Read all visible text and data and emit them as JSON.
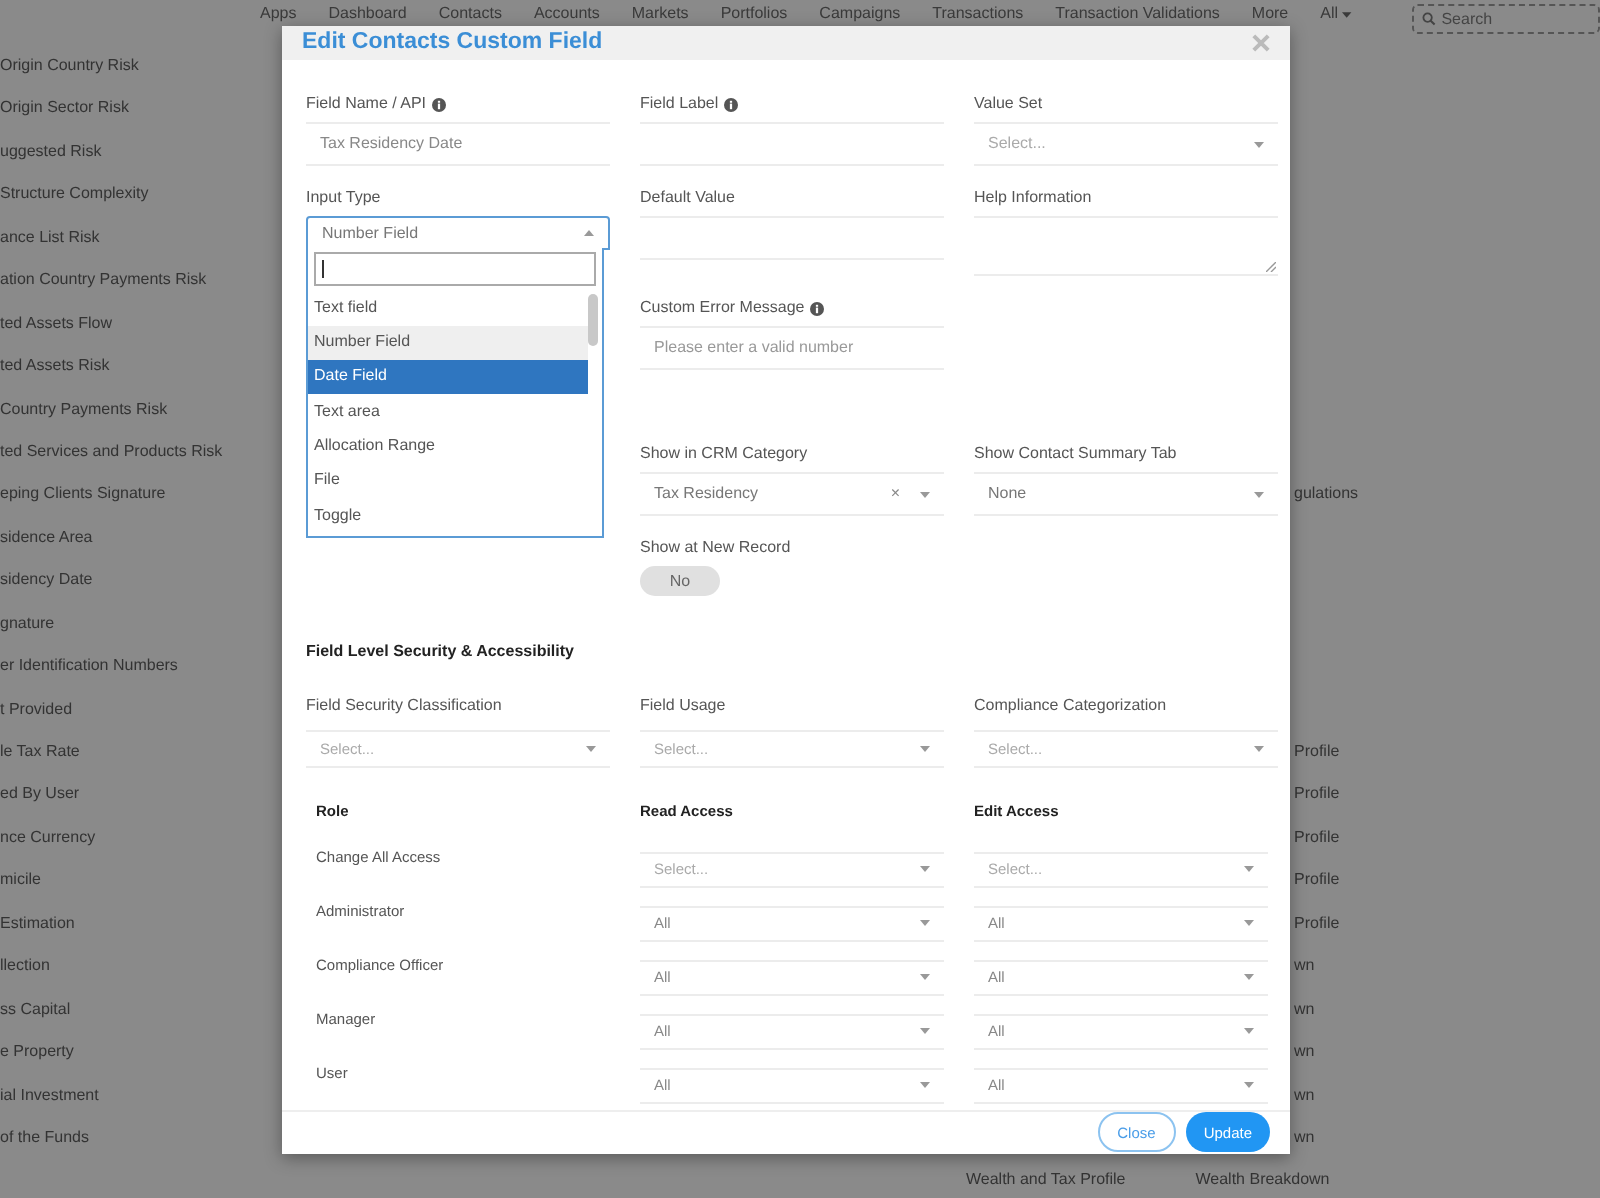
{
  "nav": {
    "items": [
      "Apps",
      "Dashboard",
      "Contacts",
      "Accounts",
      "Markets",
      "Portfolios",
      "Campaigns",
      "Transactions",
      "Transaction Validations",
      "More",
      "All"
    ],
    "search": {
      "placeholder": "Search"
    }
  },
  "background": {
    "left_list": [
      "Origin Country Risk",
      "Origin Sector Risk",
      "uggested Risk",
      "Structure Complexity",
      "ance List Risk",
      "ation Country Payments Risk",
      "ted Assets Flow",
      "ted Assets Risk",
      "Country Payments Risk",
      "ted Services and Products Risk",
      "eping Clients Signature",
      "sidence Area",
      "sidency Date",
      "gnature",
      "er Identification Numbers",
      "t Provided",
      "le Tax Rate",
      "ed By User",
      "nce Currency",
      "micile",
      "Estimation",
      "llection",
      "ss Capital",
      "e Property",
      "ial Investment",
      "of the Funds"
    ],
    "right_list": [
      "gulations",
      "Profile",
      "Profile",
      "Profile",
      "Profile",
      "Profile",
      "wn",
      "wn",
      "wn",
      "wn",
      "wn"
    ],
    "bottom_row": [
      "Wealth and Tax Profile",
      "Wealth Breakdown"
    ]
  },
  "modal": {
    "title": "Edit Contacts Custom Field",
    "fields": [
      {
        "kind": "input",
        "label": "Field Name / API",
        "info": true,
        "value": "Tax Residency Date"
      },
      {
        "kind": "input",
        "label": "Field Label",
        "info": true
      },
      {
        "kind": "select",
        "label": "Value Set",
        "placeholder": "Select..."
      },
      {
        "kind": "select",
        "label": "Input Type",
        "value": "Number Field",
        "expanded": true
      },
      {
        "kind": "input",
        "label": "Default Value"
      },
      {
        "kind": "textarea",
        "label": "Help Information"
      },
      {
        "kind": "input",
        "label": "Custom Error Message",
        "info": true,
        "placeholder": "Please enter a valid number"
      },
      {
        "kind": "select",
        "label": "Show in CRM Category",
        "value": "Tax Residency",
        "clear_label": "×"
      },
      {
        "kind": "select",
        "label": "Show Contact Summary Tab",
        "value": "None"
      },
      {
        "kind": "toggle",
        "label": "Show at New Record",
        "on": false,
        "text": "No"
      }
    ],
    "dropdown": {
      "options": [
        {
          "label": "Text field",
          "selected": false,
          "hovered": false
        },
        {
          "label": "Number Field",
          "selected": false,
          "hovered": true
        },
        {
          "label": "Date Field",
          "selected": true,
          "hovered": false
        },
        {
          "label": "Text area",
          "selected": false,
          "hovered": false
        },
        {
          "label": "Allocation Range",
          "selected": false,
          "hovered": false
        },
        {
          "label": "File",
          "selected": false,
          "hovered": false
        },
        {
          "label": "Toggle",
          "selected": false,
          "hovered": false
        }
      ]
    },
    "section_title": "Field Level Security & Accessibility",
    "security_fields": [
      {
        "label": "Field Security Classification",
        "placeholder": "Select..."
      },
      {
        "label": "Field Usage",
        "placeholder": "Select..."
      },
      {
        "label": "Compliance Categorization",
        "placeholder": "Select..."
      }
    ],
    "access_table": {
      "columns": [
        "Role",
        "Read Access",
        "Edit Access"
      ],
      "rows": [
        {
          "role": "Change All Access",
          "read": "Select...",
          "edit": "Select..."
        },
        {
          "role": "Administrator",
          "read": "All",
          "edit": "All"
        },
        {
          "role": "Compliance Officer",
          "read": "All",
          "edit": "All"
        },
        {
          "role": "Manager",
          "read": "All",
          "edit": "All"
        },
        {
          "role": "User",
          "read": "All",
          "edit": "All"
        }
      ]
    },
    "buttons": [
      {
        "label": "Close",
        "kind": "secondary"
      },
      {
        "label": "Update",
        "kind": "primary"
      }
    ]
  }
}
